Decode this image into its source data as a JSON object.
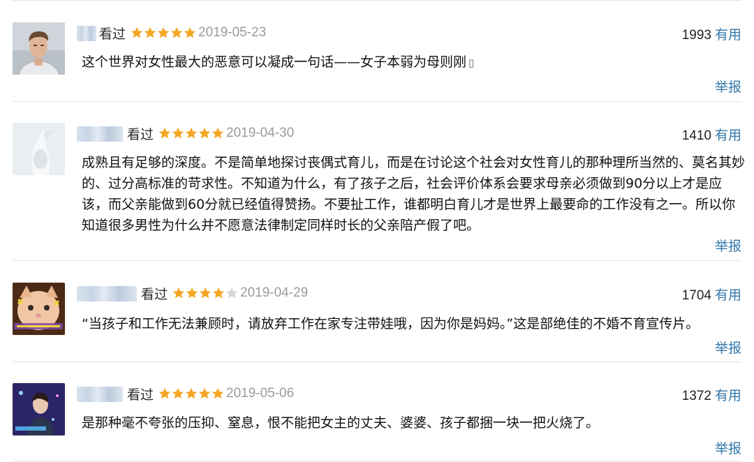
{
  "reviews": [
    {
      "watched_label": "看过",
      "rating": 5,
      "date": "2019-05-23",
      "votes": "1993",
      "useful_label": "有用",
      "content": "这个世界对女性最大的恶意可以凝成一句话——女子本弱为母则刚",
      "report_label": "举报",
      "avatar_desc": "young man portrait"
    },
    {
      "watched_label": "看过",
      "rating": 5,
      "date": "2019-04-30",
      "votes": "1410",
      "useful_label": "有用",
      "content": "成熟且有足够的深度。不是简单地探讨丧偶式育儿，而是在讨论这个社会对女性育儿的那种理所当然的、莫名其妙的、过分高标准的苛求性。不知道为什么，有了孩子之后，社会评价体系会要求母亲必须做到90分以上才是应该，而父亲能做到60分就已经值得赞扬。不要扯工作，谁都明白育儿才是世界上最要命的工作没有之一。所以你知道很多男性为什么并不愿意法律制定同样时长的父亲陪产假了吧。",
      "report_label": "举报",
      "avatar_desc": "white figurine"
    },
    {
      "watched_label": "看过",
      "rating": 4,
      "date": "2019-04-29",
      "votes": "1704",
      "useful_label": "有用",
      "content": "“当孩子和工作无法兼顾时，请放弃工作在家专注带娃哦，因为你是妈妈。”这是部绝佳的不婚不育宣传片。",
      "report_label": "举报",
      "avatar_desc": "cat meme"
    },
    {
      "watched_label": "看过",
      "rating": 5,
      "date": "2019-05-06",
      "votes": "1372",
      "useful_label": "有用",
      "content": "是那种毫不夸张的压抑、窒息，恨不能把女主的丈夫、婆婆、孩子都捆一块一把火烧了。",
      "report_label": "举报",
      "avatar_desc": "stage portrait"
    }
  ],
  "colors": {
    "star_on": "#f5a623",
    "star_off": "#d5d5d5",
    "link": "#3377aa",
    "date": "#9b9b9b",
    "divider": "#e3e3e3"
  }
}
